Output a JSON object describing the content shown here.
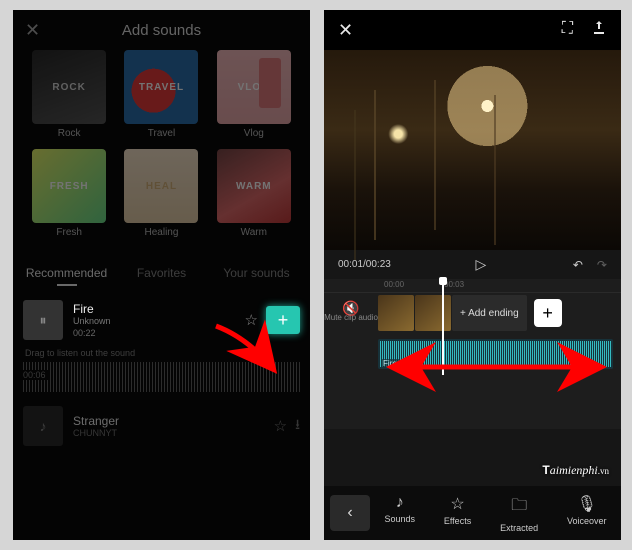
{
  "left": {
    "title": "Add sounds",
    "categories": [
      {
        "key": "rock",
        "label": "Rock",
        "word": "ROCK"
      },
      {
        "key": "travel",
        "label": "Travel",
        "word": "TRAVEL"
      },
      {
        "key": "vlog",
        "label": "Vlog",
        "word": "VLOG"
      },
      {
        "key": "fresh",
        "label": "Fresh",
        "word": "FRESH"
      },
      {
        "key": "heal",
        "label": "Healing",
        "word": "HEAL"
      },
      {
        "key": "warm",
        "label": "Warm",
        "word": "WARM"
      }
    ],
    "tabs": {
      "recommended": "Recommended",
      "favorites": "Favorites",
      "yoursounds": "Your sounds"
    },
    "tracks": [
      {
        "title": "Fire",
        "artist": "Unknown",
        "duration": "00:22"
      },
      {
        "title": "Stranger",
        "artist": "CHUNNYT",
        "duration": ""
      }
    ],
    "hint": "Drag to listen out the sound",
    "wave_time": "00:06"
  },
  "right": {
    "timecode": "00:01/00:23",
    "ruler": [
      "00:00",
      "00:03"
    ],
    "mute_label": "Mute clip audio",
    "add_ending": "+ Add ending",
    "audio_label": "Fire",
    "bottom": {
      "sounds": "Sounds",
      "effects": "Effects",
      "extracted": "Extracted",
      "voiceover": "Voiceover"
    }
  },
  "watermark": {
    "brand": "aimienphi",
    "suffix": ".vn",
    "prefix_letter": "T"
  }
}
